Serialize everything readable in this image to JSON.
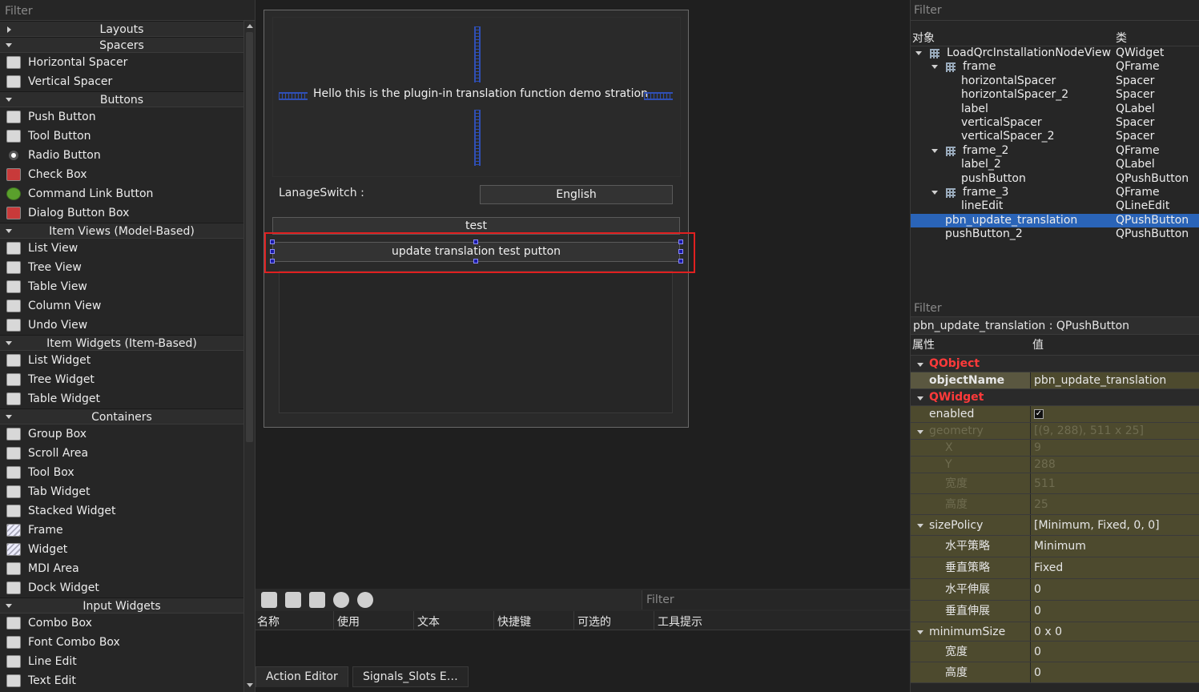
{
  "widget_box": {
    "filter_placeholder": "Filter",
    "categories": [
      {
        "label": "Layouts",
        "expanded": false,
        "items": []
      },
      {
        "label": "Spacers",
        "expanded": true,
        "items": [
          {
            "label": "Horizontal Spacer",
            "icon": "horizontal-spacer-icon"
          },
          {
            "label": "Vertical Spacer",
            "icon": "vertical-spacer-icon"
          }
        ]
      },
      {
        "label": "Buttons",
        "expanded": true,
        "items": [
          {
            "label": "Push Button",
            "icon": "push-button-icon"
          },
          {
            "label": "Tool Button",
            "icon": "tool-button-icon"
          },
          {
            "label": "Radio Button",
            "icon": "radio-button-icon"
          },
          {
            "label": "Check Box",
            "icon": "check-box-icon"
          },
          {
            "label": "Command Link Button",
            "icon": "command-link-icon"
          },
          {
            "label": "Dialog Button Box",
            "icon": "dialog-button-box-icon"
          }
        ]
      },
      {
        "label": "Item Views (Model-Based)",
        "expanded": true,
        "items": [
          {
            "label": "List View",
            "icon": "list-view-icon"
          },
          {
            "label": "Tree View",
            "icon": "tree-view-icon"
          },
          {
            "label": "Table View",
            "icon": "table-view-icon"
          },
          {
            "label": "Column View",
            "icon": "column-view-icon"
          },
          {
            "label": "Undo View",
            "icon": "undo-view-icon"
          }
        ]
      },
      {
        "label": "Item Widgets (Item-Based)",
        "expanded": true,
        "items": [
          {
            "label": "List Widget",
            "icon": "list-widget-icon"
          },
          {
            "label": "Tree Widget",
            "icon": "tree-widget-icon"
          },
          {
            "label": "Table Widget",
            "icon": "table-widget-icon"
          }
        ]
      },
      {
        "label": "Containers",
        "expanded": true,
        "items": [
          {
            "label": "Group Box",
            "icon": "group-box-icon"
          },
          {
            "label": "Scroll Area",
            "icon": "scroll-area-icon"
          },
          {
            "label": "Tool Box",
            "icon": "tool-box-icon"
          },
          {
            "label": "Tab Widget",
            "icon": "tab-widget-icon"
          },
          {
            "label": "Stacked Widget",
            "icon": "stacked-widget-icon"
          },
          {
            "label": "Frame",
            "icon": "frame-icon"
          },
          {
            "label": "Widget",
            "icon": "widget-icon"
          },
          {
            "label": "MDI Area",
            "icon": "mdi-area-icon"
          },
          {
            "label": "Dock Widget",
            "icon": "dock-widget-icon"
          }
        ]
      },
      {
        "label": "Input Widgets",
        "expanded": true,
        "items": [
          {
            "label": "Combo Box",
            "icon": "combo-box-icon"
          },
          {
            "label": "Font Combo Box",
            "icon": "font-combo-box-icon"
          },
          {
            "label": "Line Edit",
            "icon": "line-edit-icon"
          },
          {
            "label": "Text Edit",
            "icon": "text-edit-icon"
          }
        ]
      }
    ]
  },
  "form": {
    "hello_label": "Hello this is the plugin-in translation function demo stration",
    "lang_label": "LanageSwitch :",
    "lang_value": "English",
    "test_button": "test",
    "update_button": "update translation test putton"
  },
  "action_editor": {
    "filter_placeholder": "Filter",
    "columns": [
      "名称",
      "使用",
      "文本",
      "快捷键",
      "可选的",
      "工具提示"
    ],
    "tabs": [
      "Action Editor",
      "Signals_Slots E…"
    ]
  },
  "object_inspector": {
    "filter_placeholder": "Filter",
    "col_object": "对象",
    "col_class": "类",
    "rows": [
      {
        "name": "LoadQrcInstallationNodeView",
        "class": "QWidget",
        "depth": 0,
        "expand": true,
        "icon": "grid-layout-icon",
        "selected": false
      },
      {
        "name": "frame",
        "class": "QFrame",
        "depth": 1,
        "expand": true,
        "icon": "grid-layout-icon",
        "selected": false
      },
      {
        "name": "horizontalSpacer",
        "class": "Spacer",
        "depth": 2,
        "expand": false,
        "icon": "",
        "selected": false
      },
      {
        "name": "horizontalSpacer_2",
        "class": "Spacer",
        "depth": 2,
        "expand": false,
        "icon": "",
        "selected": false
      },
      {
        "name": "label",
        "class": "QLabel",
        "depth": 2,
        "expand": false,
        "icon": "",
        "selected": false
      },
      {
        "name": "verticalSpacer",
        "class": "Spacer",
        "depth": 2,
        "expand": false,
        "icon": "",
        "selected": false
      },
      {
        "name": "verticalSpacer_2",
        "class": "Spacer",
        "depth": 2,
        "expand": false,
        "icon": "",
        "selected": false
      },
      {
        "name": "frame_2",
        "class": "QFrame",
        "depth": 1,
        "expand": true,
        "icon": "hbox-layout-icon",
        "selected": false
      },
      {
        "name": "label_2",
        "class": "QLabel",
        "depth": 2,
        "expand": false,
        "icon": "",
        "selected": false
      },
      {
        "name": "pushButton",
        "class": "QPushButton",
        "depth": 2,
        "expand": false,
        "icon": "",
        "selected": false
      },
      {
        "name": "frame_3",
        "class": "QFrame",
        "depth": 1,
        "expand": true,
        "icon": "grid-layout-icon",
        "selected": false
      },
      {
        "name": "lineEdit",
        "class": "QLineEdit",
        "depth": 2,
        "expand": false,
        "icon": "",
        "selected": false
      },
      {
        "name": "pbn_update_translation",
        "class": "QPushButton",
        "depth": 1,
        "expand": false,
        "icon": "",
        "selected": true
      },
      {
        "name": "pushButton_2",
        "class": "QPushButton",
        "depth": 1,
        "expand": false,
        "icon": "",
        "selected": false
      }
    ]
  },
  "property_editor": {
    "filter_placeholder": "Filter",
    "object_line": "pbn_update_translation : QPushButton",
    "col_property": "属性",
    "col_value": "值",
    "rows": [
      {
        "kind": "group",
        "name": "QObject",
        "value": ""
      },
      {
        "kind": "bold",
        "name": "objectName",
        "value": "pbn_update_translation"
      },
      {
        "kind": "group",
        "name": "QWidget",
        "value": ""
      },
      {
        "kind": "normal",
        "name": "enabled",
        "value": "✓"
      },
      {
        "kind": "grey-expand",
        "name": "geometry",
        "value": "[(9, 288), 511 x 25]"
      },
      {
        "kind": "grey-sub",
        "name": "X",
        "value": "9"
      },
      {
        "kind": "grey-sub",
        "name": "Y",
        "value": "288"
      },
      {
        "kind": "grey-sub",
        "name": "宽度",
        "value": "511"
      },
      {
        "kind": "grey-sub",
        "name": "高度",
        "value": "25"
      },
      {
        "kind": "expand",
        "name": "sizePolicy",
        "value": "[Minimum, Fixed, 0, 0]"
      },
      {
        "kind": "sub",
        "name": "水平策略",
        "value": "Minimum"
      },
      {
        "kind": "sub",
        "name": "垂直策略",
        "value": "Fixed"
      },
      {
        "kind": "sub",
        "name": "水平伸展",
        "value": "0"
      },
      {
        "kind": "sub",
        "name": "垂直伸展",
        "value": "0"
      },
      {
        "kind": "expand",
        "name": "minimumSize",
        "value": "0 x 0"
      },
      {
        "kind": "sub",
        "name": "宽度",
        "value": "0"
      },
      {
        "kind": "sub",
        "name": "高度",
        "value": "0"
      }
    ]
  },
  "colors": {
    "accent_selection": "#2a64b8",
    "highlight_box": "#e02020",
    "property_group": "#ff3a3a",
    "property_bg": "#4d4a2e"
  }
}
